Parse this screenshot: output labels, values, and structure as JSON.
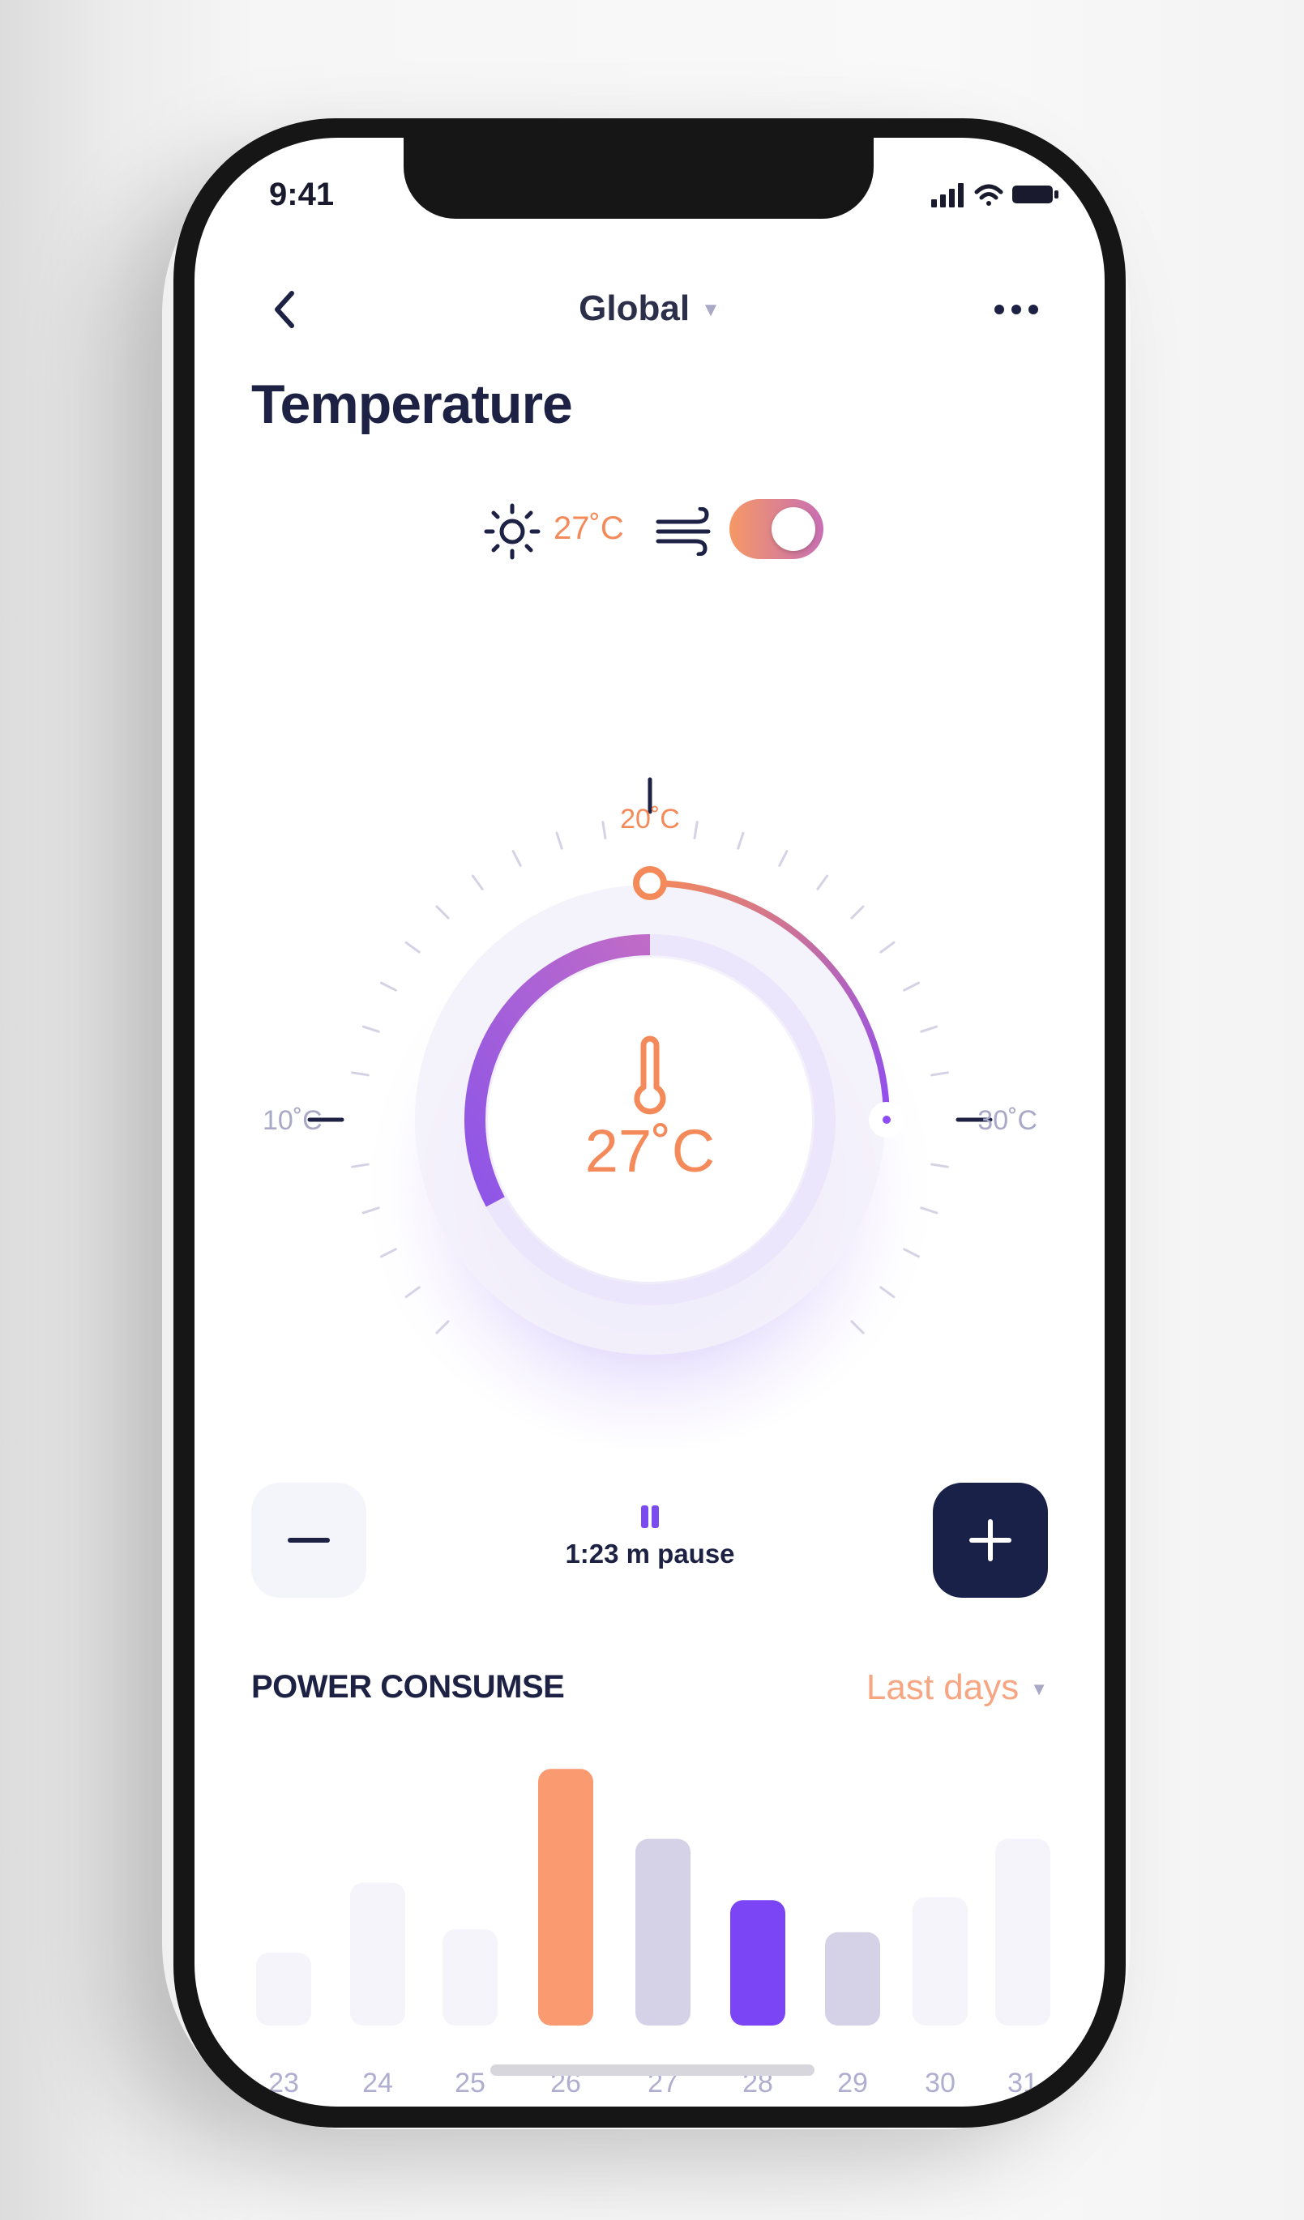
{
  "status_bar": {
    "time": "9:41"
  },
  "nav": {
    "title": "Global",
    "caret": "▼"
  },
  "page_title": "Temperature",
  "weather": {
    "current_temp": "27˚C",
    "ac_toggle_on": true
  },
  "dial": {
    "top_label": "20˚C",
    "left_label": "10˚C",
    "right_label": "30˚C",
    "center_temp": "27˚C",
    "accent_color": "#f48a5a",
    "purple_color": "#8d4cf5"
  },
  "controls": {
    "pause_text": "1:23 m pause"
  },
  "power": {
    "title": "POWER CONSUMSE",
    "range_label": "Last days",
    "range_caret": "▼"
  },
  "chart_data": {
    "type": "bar",
    "categories": [
      "23",
      "24",
      "25",
      "26",
      "27",
      "28",
      "29",
      "30",
      "31"
    ],
    "values": [
      25,
      49,
      33,
      88,
      64,
      43,
      32,
      44,
      64
    ],
    "colors": [
      "#f5f4fb",
      "#f5f4fb",
      "#f5f4fb",
      "#f99a70",
      "#d5d2e8",
      "#7b44f4",
      "#d5d2e8",
      "#f5f4fb",
      "#f5f4fb"
    ],
    "title": "",
    "xlabel": "",
    "ylabel": "",
    "ylim": [
      0,
      100
    ]
  }
}
